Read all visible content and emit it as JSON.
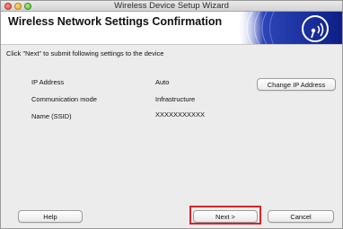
{
  "window": {
    "title": "Wireless Device Setup Wizard"
  },
  "banner": {
    "title": "Wireless Network Settings Confirmation",
    "logo_icon": "wireless-signal-icon",
    "accent_color": "#1a2f9c"
  },
  "instruction": "Click \"Next\" to submit following settings to the device",
  "settings": [
    {
      "label": "IP Address",
      "value": "Auto"
    },
    {
      "label": "Communication mode",
      "value": "Infrastructure"
    },
    {
      "label": "Name (SSID)",
      "value": "XXXXXXXXXXX"
    }
  ],
  "buttons": {
    "change_ip": "Change IP Address",
    "help": "Help",
    "next": "Next >",
    "cancel": "Cancel"
  },
  "highlight_color": "#d4252b"
}
